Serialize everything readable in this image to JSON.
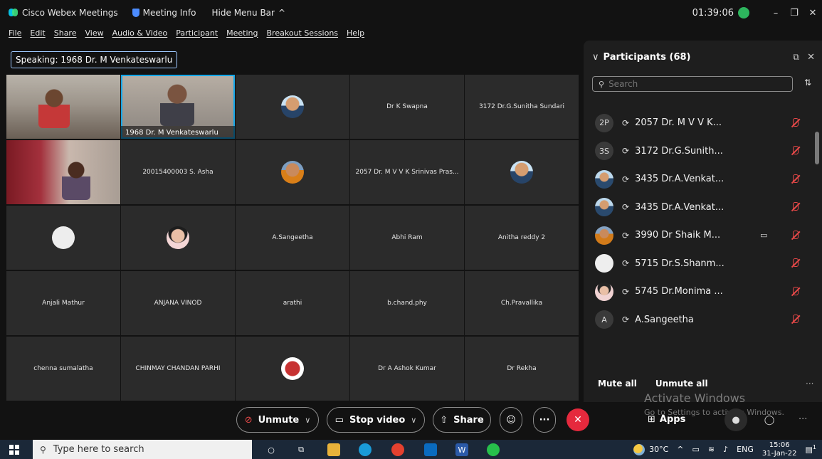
{
  "titlebar": {
    "app_name": "Cisco Webex Meetings",
    "meeting_info": "Meeting Info",
    "hide_menu": "Hide Menu Bar",
    "hide_menu_chevron": "^",
    "clock": "01:39:06",
    "min": "–",
    "restore": "❐",
    "close": "✕"
  },
  "menubar": [
    "File",
    "Edit",
    "Share",
    "View",
    "Audio & Video",
    "Participant",
    "Meeting",
    "Breakout Sessions",
    "Help"
  ],
  "speaking": "Speaking: 1968 Dr. M Venkateswarlu",
  "grid": [
    {
      "kind": "cam1",
      "name": ""
    },
    {
      "kind": "cam2",
      "name": "1968 Dr. M Venkateswarlu",
      "active": true
    },
    {
      "kind": "avatar",
      "avatar": "av-man",
      "name": ""
    },
    {
      "kind": "name",
      "name": "Dr K Swapna"
    },
    {
      "kind": "name",
      "name": "3172 Dr.G.Sunitha Sundari"
    },
    {
      "kind": "cam3",
      "name": ""
    },
    {
      "kind": "name",
      "name": "20015400003 S. Asha"
    },
    {
      "kind": "avatar",
      "avatar": "av-woman",
      "name": ""
    },
    {
      "kind": "name",
      "name": "2057 Dr. M V V K Srinivas Pras..."
    },
    {
      "kind": "avatar",
      "avatar": "av-man",
      "name": ""
    },
    {
      "kind": "avatar",
      "avatar": "av-white",
      "name": ""
    },
    {
      "kind": "avatar",
      "avatar": "av-pink",
      "name": ""
    },
    {
      "kind": "name",
      "name": "A.Sangeetha"
    },
    {
      "kind": "name",
      "name": "Abhi Ram"
    },
    {
      "kind": "name",
      "name": "Anitha reddy 2"
    },
    {
      "kind": "name",
      "name": "Anjali Mathur"
    },
    {
      "kind": "name",
      "name": "ANJANA VINOD"
    },
    {
      "kind": "name",
      "name": "arathi"
    },
    {
      "kind": "name",
      "name": "b.chand.phy"
    },
    {
      "kind": "name",
      "name": "Ch.Pravallika"
    },
    {
      "kind": "name",
      "name": "chenna sumalatha"
    },
    {
      "kind": "name",
      "name": "CHINMAY CHANDAN PARHI"
    },
    {
      "kind": "avatar",
      "avatar": "av-kl",
      "name": ""
    },
    {
      "kind": "name",
      "name": "Dr A Ashok Kumar"
    },
    {
      "kind": "name",
      "name": "Dr Rekha"
    }
  ],
  "panel": {
    "title": "Participants (68)",
    "chevron": "∨",
    "popout": "⧉",
    "close": "✕",
    "search_placeholder": "Search",
    "sort": "⇅",
    "participants": [
      {
        "avatar": "letter",
        "initials": "2P",
        "name": "2057 Dr. M V V K...",
        "camera": false
      },
      {
        "avatar": "letter",
        "initials": "3S",
        "name": "3172 Dr.G.Sunith...",
        "camera": false
      },
      {
        "avatar": "photo-man",
        "initials": "",
        "name": "3435 Dr.A.Venkat...",
        "camera": false
      },
      {
        "avatar": "photo-man",
        "initials": "",
        "name": "3435 Dr.A.Venkat...",
        "camera": false
      },
      {
        "avatar": "photo-woman",
        "initials": "",
        "name": "3990 Dr Shaik M...",
        "camera": true
      },
      {
        "avatar": "white",
        "initials": "",
        "name": "5715 Dr.S.Shanm...",
        "camera": false
      },
      {
        "avatar": "photo-pink",
        "initials": "",
        "name": "5745 Dr.Monima ...",
        "camera": false
      },
      {
        "avatar": "letter",
        "initials": "A",
        "name": "A.Sangeetha",
        "camera": false
      }
    ],
    "mute_all": "Mute all",
    "unmute_all": "Unmute all",
    "more": "···"
  },
  "watermark": {
    "line1": "Activate Windows",
    "line2": "Go to Settings to activate Windows."
  },
  "controls": {
    "unmute": "Unmute",
    "stop_video": "Stop video",
    "share": "Share",
    "more": "···",
    "apps": "Apps"
  },
  "taskbar": {
    "search_placeholder": "Type here to search",
    "temperature": "30°C",
    "lang": "ENG",
    "time": "15:06",
    "date": "31-Jan-22",
    "notif_count": "1"
  },
  "colors": {
    "accent_blue": "#14a6e8",
    "mute_red": "#e64848",
    "leave_red": "#e5293d",
    "panel_bg": "#1e1e1e",
    "tile_bg": "#2b2b2b"
  }
}
